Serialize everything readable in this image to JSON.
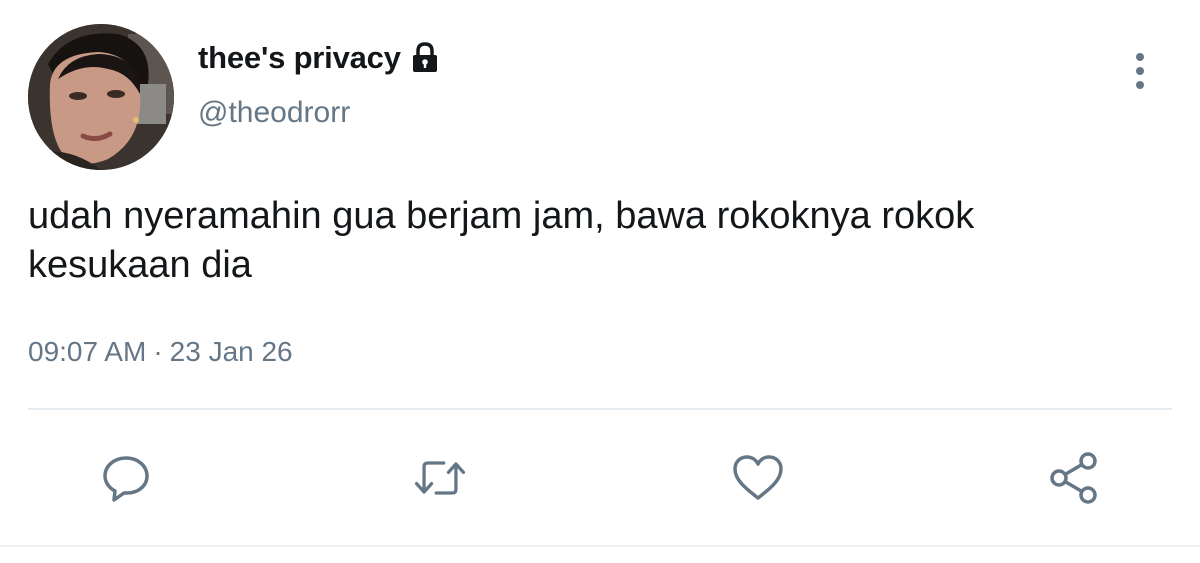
{
  "user": {
    "display_name": "thee's privacy",
    "handle": "@theodrorr",
    "protected_icon": "lock-icon"
  },
  "tweet": {
    "text_line1": "udah nyeramahin gua berjam jam, bawa rokoknya rokok",
    "text_line2": "kesukaan dia",
    "time": "09:07 AM",
    "separator": "·",
    "date": "23 Jan 26"
  },
  "actions": [
    {
      "name": "reply",
      "icon": "reply-icon"
    },
    {
      "name": "retweet",
      "icon": "retweet-icon"
    },
    {
      "name": "like",
      "icon": "heart-icon"
    },
    {
      "name": "share",
      "icon": "share-icon"
    }
  ],
  "menu_icon": "more-vertical-icon",
  "colors": {
    "text_primary": "#14171a",
    "text_secondary": "#657786",
    "icon_gray": "#657786",
    "divider": "#e6ecf0"
  }
}
